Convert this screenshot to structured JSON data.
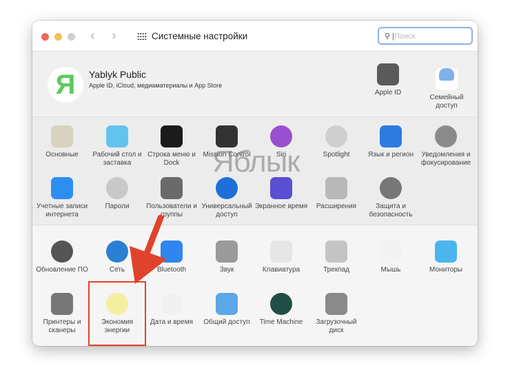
{
  "window": {
    "title": "Системные настройки",
    "search_placeholder": "Поиск"
  },
  "account": {
    "avatar_letter": "Я",
    "name": "Yablyk Public",
    "subtitle": "Apple ID, iCloud, медиаматериалы и App Store",
    "items": [
      {
        "label": "Apple ID",
        "color": "#5a5a5a"
      },
      {
        "label": "Семейный доступ",
        "color": "#7fb2ea"
      }
    ]
  },
  "section1": [
    {
      "label": "Основные",
      "color": "#d8d2c0",
      "icon": "general-icon"
    },
    {
      "label": "Рабочий стол и заставка",
      "color": "#63c3ef",
      "icon": "desktop-icon"
    },
    {
      "label": "Строка меню и Dock",
      "color": "#1b1b1b",
      "icon": "dock-icon"
    },
    {
      "label": "Mission Control",
      "color": "#333",
      "icon": "mission-control-icon"
    },
    {
      "label": "Siri",
      "color": "#9a4fd0",
      "icon": "siri-icon",
      "round": true
    },
    {
      "label": "Spotlight",
      "color": "#cfcfcf",
      "icon": "spotlight-icon",
      "round": true
    },
    {
      "label": "Язык и регион",
      "color": "#2d7be0",
      "icon": "flag-icon"
    },
    {
      "label": "Уведомления и фокусирование",
      "color": "#8a8a8a",
      "icon": "bell-icon",
      "round": true
    },
    {
      "label": "Учетные записи интернета",
      "color": "#2e8ef0",
      "icon": "at-icon"
    },
    {
      "label": "Пароли",
      "color": "#c8c8c8",
      "icon": "key-icon",
      "round": true
    },
    {
      "label": "Пользователи и группы",
      "color": "#6a6a6a",
      "icon": "users-icon"
    },
    {
      "label": "Универсальный доступ",
      "color": "#1f6fd8",
      "icon": "accessibility-icon",
      "round": true
    },
    {
      "label": "Экранное время",
      "color": "#5a4fd0",
      "icon": "hourglass-icon"
    },
    {
      "label": "Расширения",
      "color": "#b8b8b8",
      "icon": "puzzle-icon"
    },
    {
      "label": "Защита и безопасность",
      "color": "#777",
      "icon": "house-lock-icon",
      "round": true
    }
  ],
  "section2": [
    {
      "label": "Обновление ПО",
      "color": "#555",
      "icon": "gear-icon",
      "round": true
    },
    {
      "label": "Сеть",
      "color": "#2a7fd4",
      "icon": "globe-icon",
      "round": true
    },
    {
      "label": "Bluetooth",
      "color": "#2f86ee",
      "icon": "bluetooth-icon"
    },
    {
      "label": "Звук",
      "color": "#9a9a9a",
      "icon": "speaker-icon"
    },
    {
      "label": "Клавиатура",
      "color": "#e6e6e6",
      "icon": "keyboard-icon"
    },
    {
      "label": "Трекпад",
      "color": "#c4c4c4",
      "icon": "trackpad-icon"
    },
    {
      "label": "Мышь",
      "color": "#f2f2f2",
      "icon": "mouse-icon"
    },
    {
      "label": "Мониторы",
      "color": "#4bb6ee",
      "icon": "monitor-icon"
    },
    {
      "label": "Принтеры и сканеры",
      "color": "#777",
      "icon": "printer-icon"
    },
    {
      "label": "Экономия энергии",
      "color": "#f4eea0",
      "icon": "lightbulb-icon",
      "round": true
    },
    {
      "label": "Дата и время",
      "color": "#f0f0f0",
      "icon": "clock-icon",
      "round": true
    },
    {
      "label": "Общий доступ",
      "color": "#5aa8e8",
      "icon": "folder-icon"
    },
    {
      "label": "Time Machine",
      "color": "#1f4f45",
      "icon": "time-machine-icon",
      "round": true
    },
    {
      "label": "Загрузочный диск",
      "color": "#8a8a8a",
      "icon": "disk-icon"
    }
  ],
  "watermark": "Яблык",
  "annotation_color": "#e0432b"
}
